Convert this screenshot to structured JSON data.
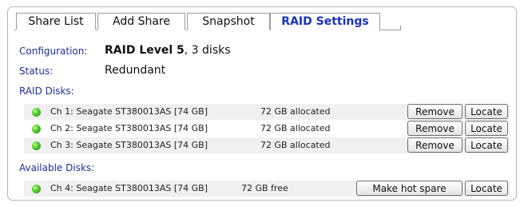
{
  "tabs": [
    "Share List",
    "Add Share",
    "Snapshot",
    "RAID Settings"
  ],
  "active_tab": "RAID Settings",
  "configuration": {
    "label": "Configuration:",
    "level": "RAID Level 5",
    "disks": ", 3 disks"
  },
  "status": {
    "label": "Status:",
    "value": "Redundant"
  },
  "raid_disks": {
    "label": "RAID Disks:",
    "rows": [
      {
        "name": "Ch 1: Seagate ST380013AS [74 GB]",
        "alloc": "72 GB allocated",
        "btn1": "Remove",
        "btn2": "Locate"
      },
      {
        "name": "Ch 2: Seagate ST380013AS [74 GB]",
        "alloc": "72 GB allocated",
        "btn1": "Remove",
        "btn2": "Locate"
      },
      {
        "name": "Ch 3: Seagate ST380013AS [74 GB]",
        "alloc": "72 GB allocated",
        "btn1": "Remove",
        "btn2": "Locate"
      }
    ]
  },
  "available_disks": {
    "label": "Available Disks:",
    "rows": [
      {
        "name": "Ch 4: Seagate ST380013AS [74 GB]",
        "free": "72 GB free",
        "btn1": "Make hot spare",
        "btn2": "Locate"
      }
    ]
  },
  "colors": {
    "accent": "#1a32b8",
    "label": "#1e2f9a",
    "status_ok": "#4ec72a"
  },
  "icons": {
    "disk_status": "green-status-dot-icon"
  }
}
